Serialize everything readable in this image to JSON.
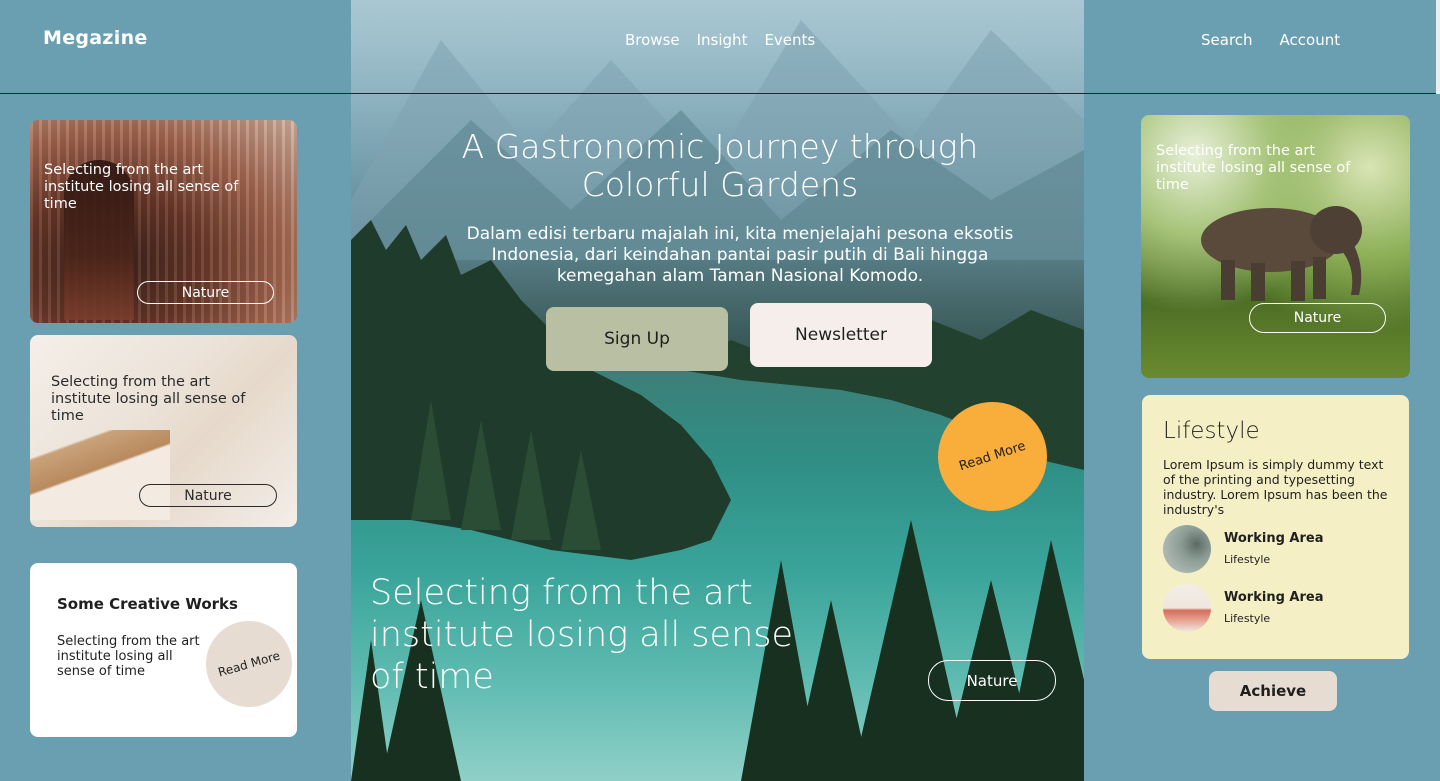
{
  "header": {
    "logo": "Megazine",
    "nav_center": [
      "Browse",
      "Insight",
      "Events"
    ],
    "nav_right": [
      "Search",
      "Account"
    ]
  },
  "left_cards": [
    {
      "text": "Selecting from the art institute losing all sense of time",
      "tag": "Nature"
    },
    {
      "text": "Selecting from the art institute losing all sense of time",
      "tag": "Nature"
    }
  ],
  "creative": {
    "title": "Some Creative Works",
    "text": "Selecting from the art institute losing all sense of time",
    "cta": "Read More"
  },
  "hero": {
    "title": "A Gastronomic Journey through Colorful Gardens",
    "subtitle": "Dalam edisi terbaru majalah ini, kita menjelajahi pesona eksotis Indonesia, dari keindahan pantai pasir putih di Bali hingga kemegahan alam Taman Nasional Komodo.",
    "signup_label": "Sign Up",
    "newsletter_label": "Newsletter",
    "read_more_label": "Read More",
    "bottom_text": "Selecting from the art institute losing all sense of time",
    "tag": "Nature"
  },
  "right_card": {
    "text": "Selecting from the art institute losing all sense of time",
    "tag": "Nature"
  },
  "lifestyle": {
    "title": "Lifestyle",
    "desc": "Lorem Ipsum is simply dummy text of the printing and typesetting industry. Lorem Ipsum has been the industry's",
    "items": [
      {
        "title": "Working Area",
        "subtitle": "Lifestyle"
      },
      {
        "title": "Working Area",
        "subtitle": "Lifestyle"
      }
    ]
  },
  "achieve_label": "Achieve",
  "colors": {
    "background": "#6a9fb1",
    "accent_orange": "#f9ad3a",
    "signup_green": "#b9bfa3",
    "lifestyle_yellow": "#f5efc5"
  }
}
